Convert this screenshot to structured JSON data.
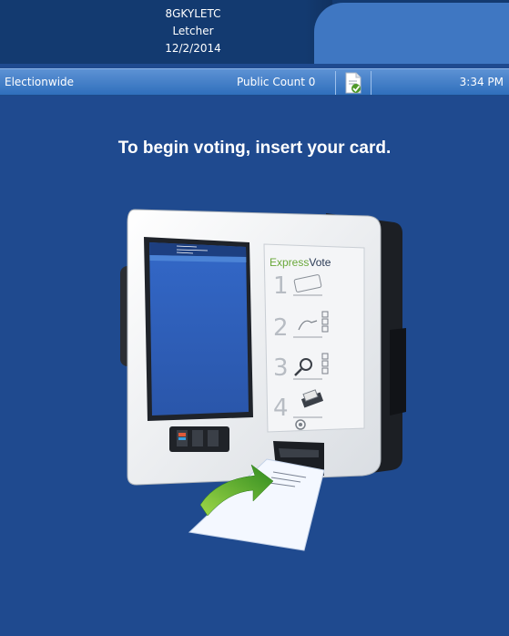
{
  "header": {
    "line1": "8GKYLETC",
    "line2": "Letcher",
    "line3": "12/2/2014"
  },
  "status_bar": {
    "mode": "Electionwide",
    "public_count": "Public Count 0",
    "time": "3:34 PM",
    "icon": "document-check-icon"
  },
  "main": {
    "instruction": "To begin voting, insert your card."
  },
  "device": {
    "brand_prefix": "Express",
    "brand_suffix": "Vote",
    "steps": [
      "1",
      "2",
      "3",
      "4"
    ],
    "accent_color": "#6aa83a"
  }
}
